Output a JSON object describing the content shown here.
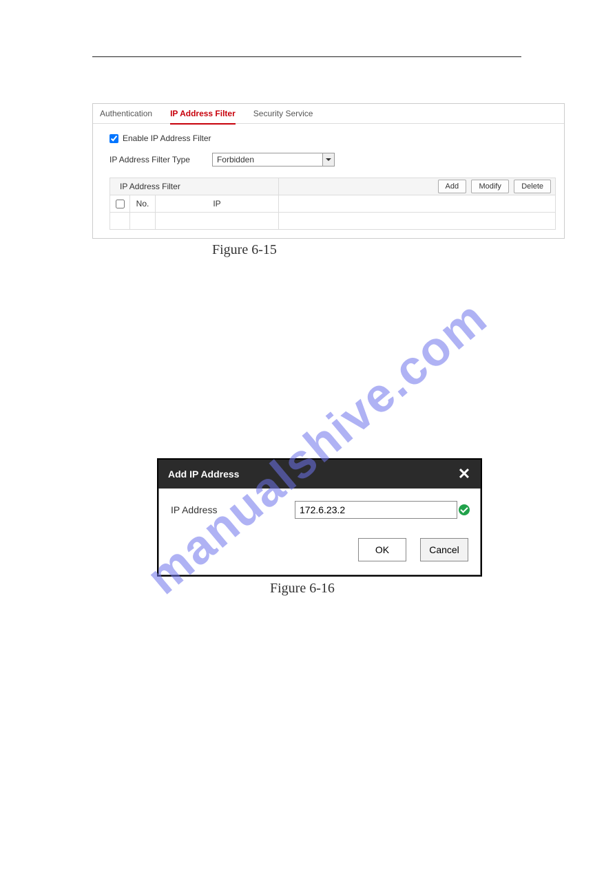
{
  "watermark": "manualshive.com",
  "captions": {
    "fig615": "Figure 6-15",
    "fig616": "Figure 6-16"
  },
  "panel615": {
    "tabs": [
      "Authentication",
      "IP Address Filter",
      "Security Service"
    ],
    "enable_label": "Enable IP Address Filter",
    "filter_type_label": "IP Address Filter Type",
    "filter_type_value": "Forbidden",
    "table": {
      "title": "IP Address Filter",
      "buttons": [
        "Add",
        "Modify",
        "Delete"
      ],
      "headers": [
        "No.",
        "IP"
      ]
    }
  },
  "dialog": {
    "title": "Add IP Address",
    "ip_label": "IP Address",
    "ip_value": "172.6.23.2",
    "ok": "OK",
    "cancel": "Cancel"
  }
}
